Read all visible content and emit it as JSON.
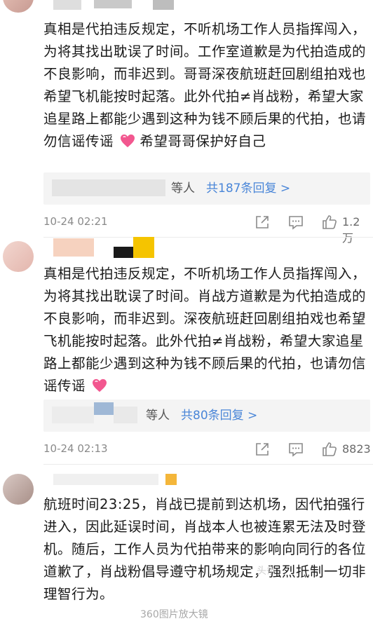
{
  "comments": [
    {
      "text": "真相是代拍违反规定，不听机场工作人员指挥闯入，为将其找出耽误了时间。工作室道歉是为代拍造成的不良影响，而非迟到。哥哥深夜航班赶回剧组拍戏也希望飞机能按时起落。此外代拍≠肖战粉，希望大家追星路上都能少遇到这种为钱不顾后果的代拍，也请勿信谣传谣",
      "text_tail": "希望哥哥保护好自己",
      "reply_who": "等人",
      "reply_count": "共187条回复 >",
      "time": "10-24 02:21",
      "likes": "1.2万"
    },
    {
      "text": "真相是代拍违反规定，不听机场工作人员指挥闯入，为将其找出耽误了时间。肖战方道歉是为代拍造成的不良影响，而非迟到。深夜航班赶回剧组拍戏也希望飞机能按时起落。此外代拍≠肖战粉，希望大家追星路上都能少遇到这种为钱不顾后果的代拍，也请勿信谣传谣",
      "reply_who": "等人",
      "reply_count": "共80条回复 >",
      "time": "10-24 02:13",
      "likes": "8823"
    },
    {
      "text": "航班时间23:25，肖战已提前到达机场，因代拍强行进入，因此延误时间，肖战本人也被连累无法及时登机。随后，工作人员为代拍带来的影响向同行的各位道歉了，肖战粉倡导遵守机场规定，强烈抵制一切非理智行为。"
    }
  ],
  "watermark": "头条",
  "cutoff_text": "360图片放大镜",
  "colors": {
    "link": "#4a86d8",
    "meta": "#8a8a8a",
    "heart": "#f2578f"
  },
  "icons": [
    "share-icon",
    "comment-icon",
    "like-icon",
    "heart-emoji-icon"
  ]
}
